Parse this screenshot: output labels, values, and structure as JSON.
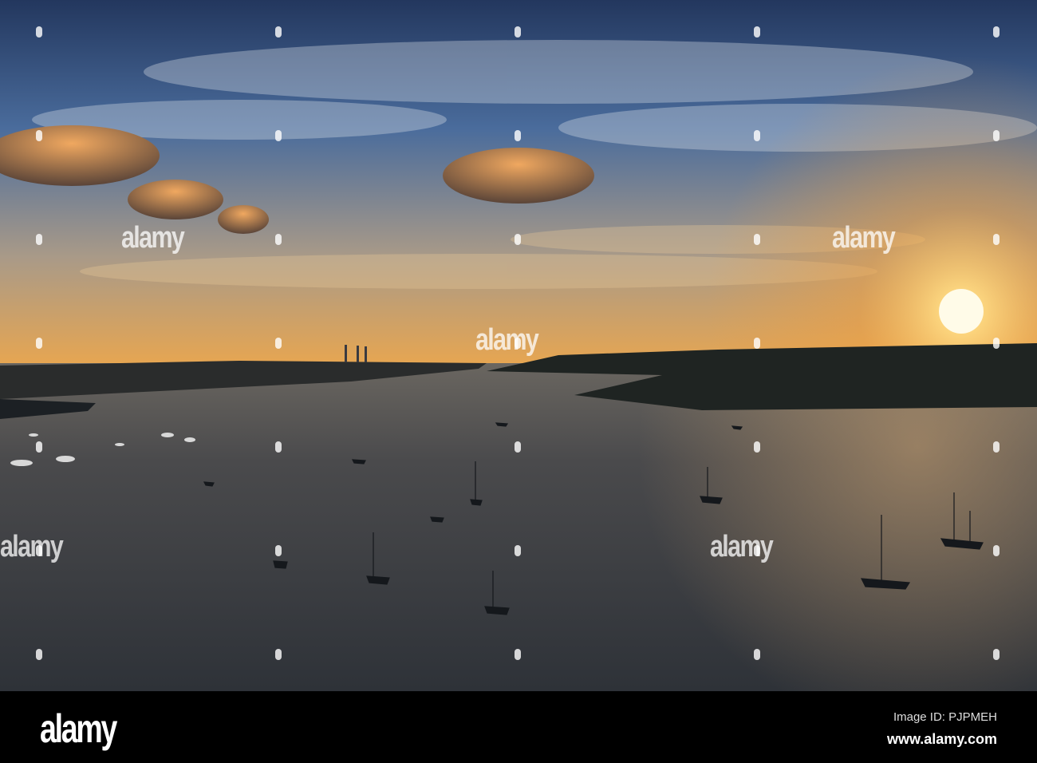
{
  "watermark": {
    "text": "alamy"
  },
  "footer": {
    "logo": "alamy",
    "image_id": "Image ID: PJPMEH",
    "site": "www.alamy.com"
  },
  "colors": {
    "sky_top": "#2d4a78",
    "sky_mid": "#5d7ea8",
    "horizon": "#f0a848",
    "sun": "#fff4c0",
    "water": "#3a3e44",
    "footer": "#000000"
  }
}
